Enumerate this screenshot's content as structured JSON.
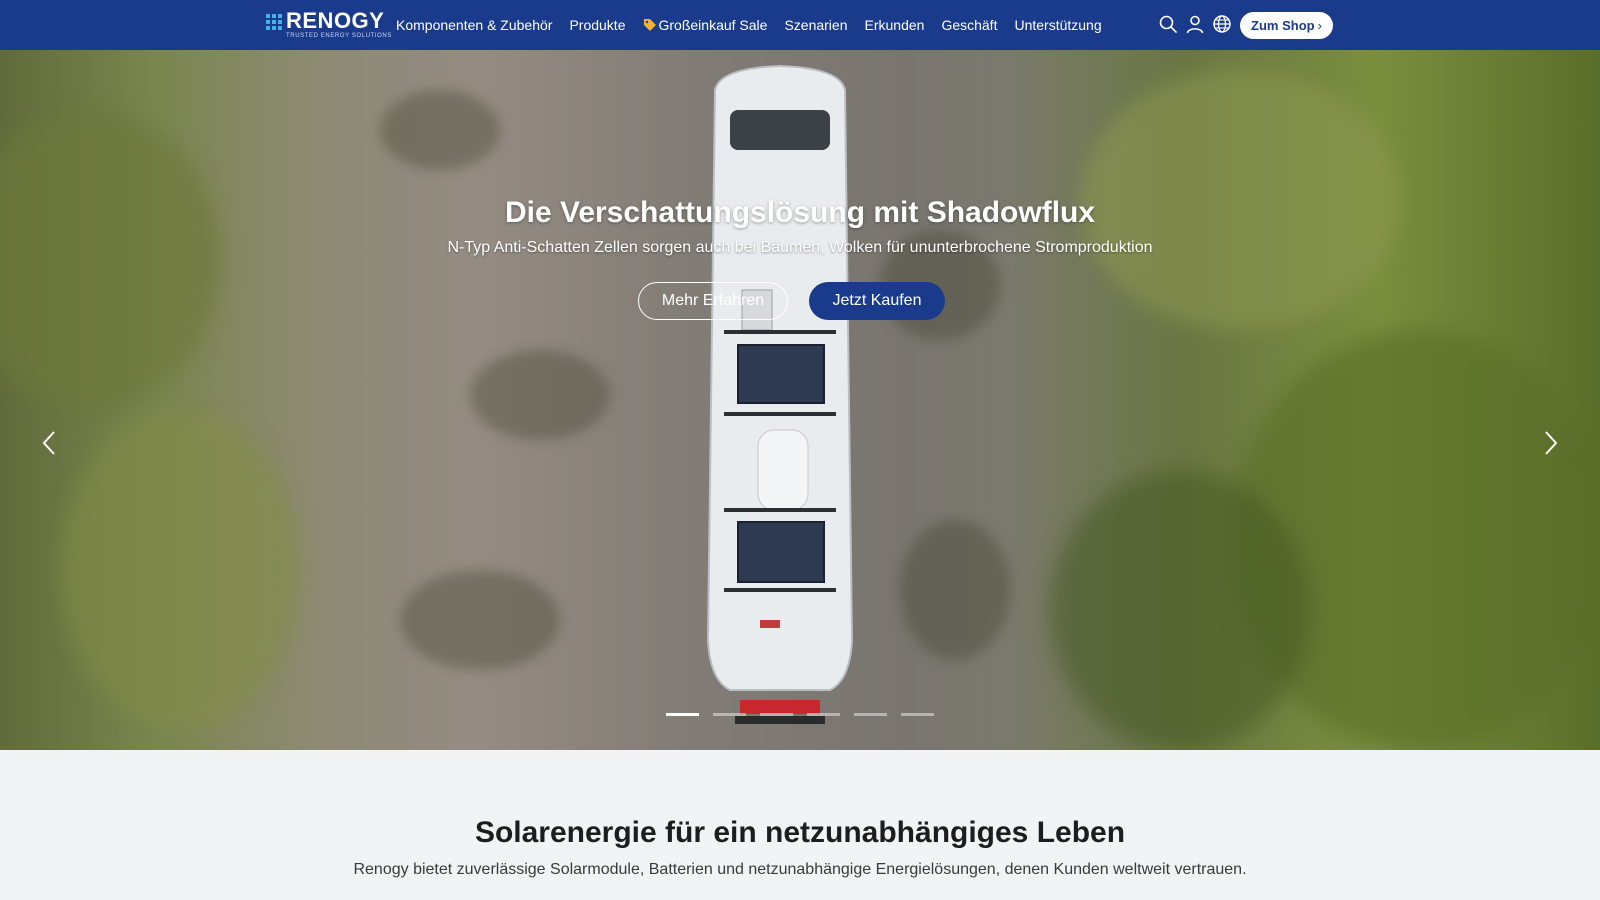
{
  "brand": {
    "name": "RENOGY",
    "tagline": "TRUSTED ENERGY SOLUTIONS",
    "color": "#1a3a8c"
  },
  "nav": {
    "items": [
      {
        "label": "Komponenten & Zubehör"
      },
      {
        "label": "Produkte"
      },
      {
        "label": "Großeinkauf Sale",
        "icon": "price-tag-icon"
      },
      {
        "label": "Szenarien"
      },
      {
        "label": "Erkunden"
      },
      {
        "label": "Geschäft"
      },
      {
        "label": "Unterstützung"
      }
    ],
    "icons": [
      "search-icon",
      "user-icon",
      "globe-icon"
    ],
    "shop_button": "Zum Shop",
    "shop_chevron": "›"
  },
  "hero": {
    "title": "Die Verschattungslösung mit Shadowflux",
    "subtitle": "N-Typ Anti-Schatten Zellen sorgen auch bei Bäumen, Wolken für ununterbrochene Stromproduktion",
    "primary_button": "Jetzt Kaufen",
    "secondary_button": "Mehr Erfahren",
    "slides_count": 6,
    "active_slide": 1
  },
  "section": {
    "title": "Solarenergie für ein netzunabhängiges Leben",
    "subtitle": "Renogy bietet zuverlässige Solarmodule, Batterien und netzunabhängige Energielösungen, denen Kunden weltweit vertrauen."
  }
}
